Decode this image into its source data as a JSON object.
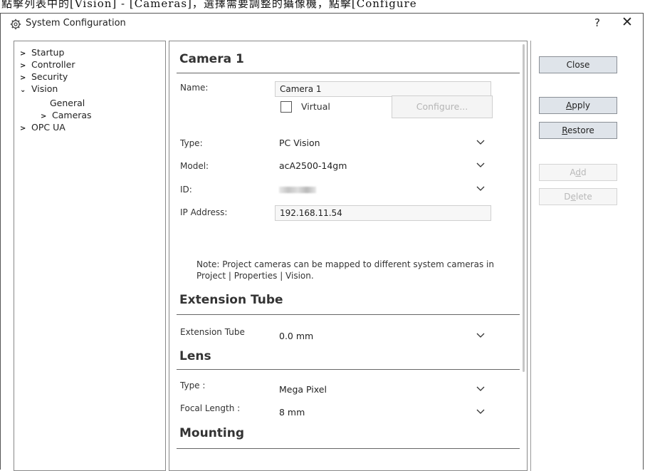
{
  "top_strip": "點擊列表中的[Vision] - [Cameras]，選擇需要調整的攝像機，點擊[Configure",
  "window": {
    "title": "System Configuration",
    "help": "?",
    "close": "✕"
  },
  "tree": {
    "startup": "Startup",
    "controller": "Controller",
    "security": "Security",
    "vision": "Vision",
    "general": "General",
    "cameras": "Cameras",
    "opcua": "OPC UA"
  },
  "camera": {
    "heading": "Camera 1",
    "name_label": "Name:",
    "name_value": "Camera 1",
    "virtual_label": "Virtual",
    "virtual_checked": false,
    "configure_label": "Configure...",
    "type_label": "Type:",
    "type_value": "PC Vision",
    "model_label": "Model:",
    "model_value": "acA2500-14gm",
    "id_label": "ID:",
    "ip_label": "IP Address:",
    "ip_value": "192.168.11.54",
    "note_line1": "Note: Project cameras can be mapped to different system cameras in",
    "note_line2": "Project | Properties | Vision."
  },
  "extension_tube": {
    "heading": "Extension Tube",
    "label": "Extension Tube",
    "value": "0.0 mm"
  },
  "lens": {
    "heading": "Lens",
    "type_label": "Type :",
    "type_value": "Mega Pixel",
    "focal_label": "Focal Length :",
    "focal_value": "8 mm"
  },
  "mounting": {
    "heading": "Mounting"
  },
  "buttons": {
    "close": "Close",
    "apply_key": "A",
    "apply_rest": "pply",
    "restore_key": "R",
    "restore_rest": "estore",
    "add_pre": "A",
    "add_key": "d",
    "add_post": "d",
    "delete_pre": "D",
    "delete_key": "e",
    "delete_post": "lete"
  }
}
